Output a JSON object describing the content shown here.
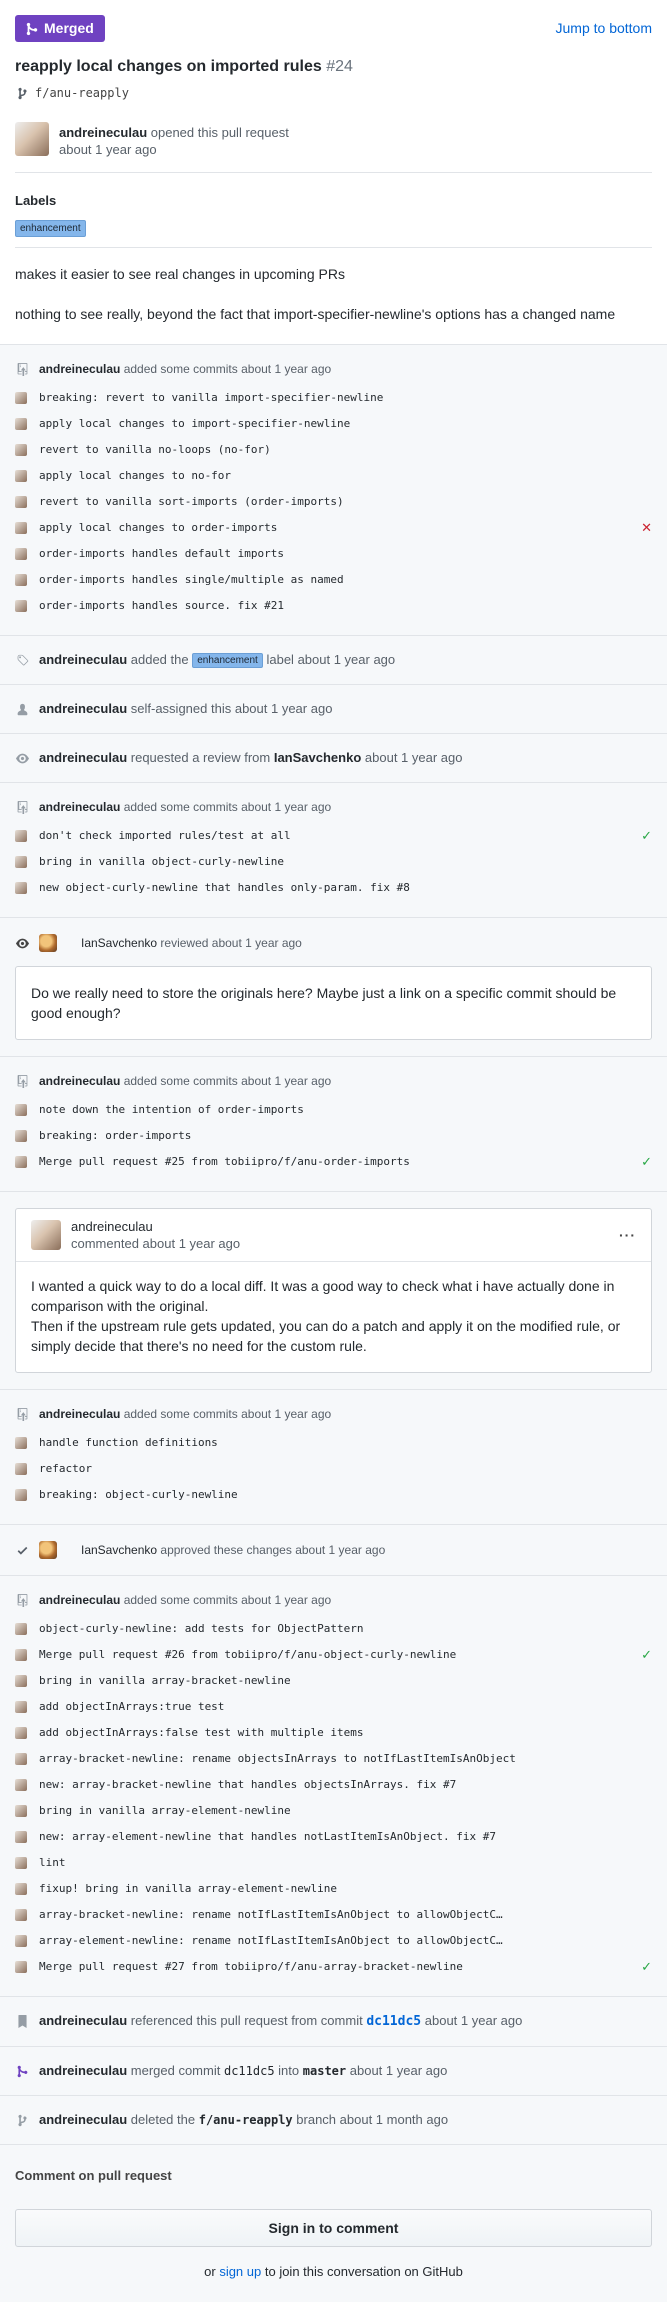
{
  "header": {
    "merged_label": "Merged",
    "jump_label": "Jump to bottom",
    "title": "reapply local changes on imported rules",
    "number": "#24",
    "branch": "f/anu-reapply"
  },
  "opened": {
    "author": "andreineculau",
    "action": "opened this pull request",
    "time": "about 1 year ago"
  },
  "labels": {
    "heading": "Labels",
    "items": [
      "enhancement"
    ]
  },
  "body": {
    "p1": "makes it easier to see real changes in upcoming PRs",
    "p2": "nothing to see really, beyond the fact that import-specifier-newline's options has a changed name"
  },
  "colors": {
    "merged": "#6f42c1",
    "link": "#0366d6",
    "success": "#28a745",
    "failure": "#cb2431",
    "label": "#84b6eb"
  },
  "timeline": {
    "c1": {
      "author": "andreineculau",
      "action": "added some commits",
      "time": "about 1 year ago",
      "commits": [
        {
          "msg": "breaking: revert to vanilla import-specifier-newline",
          "status": ""
        },
        {
          "msg": "apply local changes to import-specifier-newline",
          "status": ""
        },
        {
          "msg": "revert to vanilla no-loops (no-for)",
          "status": ""
        },
        {
          "msg": "apply local changes to no-for",
          "status": ""
        },
        {
          "msg": "revert to vanilla sort-imports (order-imports)",
          "status": ""
        },
        {
          "msg": "apply local changes to order-imports",
          "status": "✕"
        },
        {
          "msg": "order-imports handles default imports",
          "status": ""
        },
        {
          "msg": "order-imports handles single/multiple as named",
          "status": ""
        },
        {
          "msg": "order-imports handles source. fix #21",
          "status": ""
        }
      ]
    },
    "label_event": {
      "author": "andreineculau",
      "pre": "added the",
      "label": "enhancement",
      "post": "label",
      "time": "about 1 year ago"
    },
    "assign_event": {
      "author": "andreineculau",
      "action": "self-assigned this",
      "time": "about 1 year ago"
    },
    "review_request": {
      "author": "andreineculau",
      "action": "requested a review from",
      "target": "IanSavchenko",
      "time": "about 1 year ago"
    },
    "c2": {
      "author": "andreineculau",
      "action": "added some commits",
      "time": "about 1 year ago",
      "commits": [
        {
          "msg": "don't check imported rules/test at all",
          "status": "✓"
        },
        {
          "msg": "bring in vanilla object-curly-newline",
          "status": ""
        },
        {
          "msg": "new object-curly-newline that handles only-param. fix #8",
          "status": ""
        }
      ]
    },
    "review": {
      "author": "IanSavchenko",
      "action": "reviewed",
      "time": "about 1 year ago",
      "text": "Do we really need to store the originals here? Maybe just a link on a specific commit should be good enough?"
    },
    "c3": {
      "author": "andreineculau",
      "action": "added some commits",
      "time": "about 1 year ago",
      "commits": [
        {
          "msg": "note down the intention of order-imports",
          "status": ""
        },
        {
          "msg": "breaking: order-imports",
          "status": ""
        },
        {
          "msg": "Merge pull request #25 from tobiipro/f/anu-order-imports",
          "status": "✓"
        }
      ]
    },
    "comment": {
      "author": "andreineculau",
      "action": "commented",
      "time": "about 1 year ago",
      "menu": "···",
      "line1": "I wanted a quick way to do a local diff. It was a good way to check what i have actually done in comparison with the original.",
      "line2": "Then if the upstream rule gets updated, you can do a patch and apply it on the modified rule, or simply decide that there's no need for the custom rule."
    },
    "c4": {
      "author": "andreineculau",
      "action": "added some commits",
      "time": "about 1 year ago",
      "commits": [
        {
          "msg": "handle function definitions",
          "status": ""
        },
        {
          "msg": "refactor",
          "status": ""
        },
        {
          "msg": "breaking: object-curly-newline",
          "status": ""
        }
      ]
    },
    "approve": {
      "author": "IanSavchenko",
      "action": "approved these changes",
      "time": "about 1 year ago"
    },
    "c5": {
      "author": "andreineculau",
      "action": "added some commits",
      "time": "about 1 year ago",
      "commits": [
        {
          "msg": "object-curly-newline: add tests for ObjectPattern",
          "status": ""
        },
        {
          "msg": "Merge pull request #26 from tobiipro/f/anu-object-curly-newline",
          "status": "✓"
        },
        {
          "msg": "bring in vanilla array-bracket-newline",
          "status": ""
        },
        {
          "msg": "add objectInArrays:true test",
          "status": ""
        },
        {
          "msg": "add objectInArrays:false test with multiple items",
          "status": ""
        },
        {
          "msg": "array-bracket-newline: rename objectsInArrays to notIfLastItemIsAnObject",
          "status": ""
        },
        {
          "msg": "new: array-bracket-newline that handles objectsInArrays. fix #7",
          "status": ""
        },
        {
          "msg": "bring in vanilla array-element-newline",
          "status": ""
        },
        {
          "msg": "new: array-element-newline that handles notLastItemIsAnObject. fix #7",
          "status": ""
        },
        {
          "msg": "lint",
          "status": ""
        },
        {
          "msg": "fixup! bring in vanilla array-element-newline",
          "status": ""
        },
        {
          "msg": "array-bracket-newline: rename notIfLastItemIsAnObject to allowObjectC…",
          "status": ""
        },
        {
          "msg": "array-element-newline: rename notIfLastItemIsAnObject to allowObjectC…",
          "status": ""
        },
        {
          "msg": "Merge pull request #27 from tobiipro/f/anu-array-bracket-newline",
          "status": "✓"
        }
      ]
    },
    "reference": {
      "author": "andreineculau",
      "action": "referenced this pull request from commit",
      "sha": "dc11dc5",
      "time": "about 1 year ago"
    },
    "merge": {
      "author": "andreineculau",
      "pre": "merged commit",
      "sha": "dc11dc5",
      "mid": "into",
      "branch": "master",
      "time": "about 1 year ago"
    },
    "delete": {
      "author": "andreineculau",
      "pre": "deleted the",
      "branch": "f/anu-reapply",
      "post": "branch",
      "time": "about 1 month ago"
    }
  },
  "footer": {
    "heading": "Comment on pull request",
    "signin": "Sign in to comment",
    "join_pre": "or",
    "join_link": "sign up",
    "join_post": "to join this conversation on GitHub"
  }
}
